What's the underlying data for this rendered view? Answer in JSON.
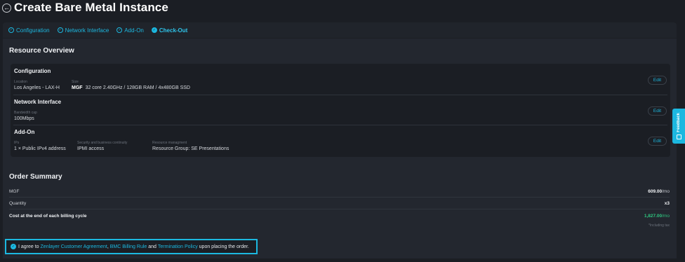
{
  "header": {
    "title": "Create Bare Metal Instance",
    "back_icon": "arrow-left-icon"
  },
  "steps": [
    {
      "label": "Configuration",
      "state": "done"
    },
    {
      "label": "Network Interface",
      "state": "done"
    },
    {
      "label": "Add-On",
      "state": "done"
    },
    {
      "label": "Check-Out",
      "state": "active"
    }
  ],
  "resource_overview": {
    "title": "Resource Overview",
    "edit_label": "Edit",
    "configuration": {
      "title": "Configuration",
      "location_label": "Location",
      "location_value": "Los Angeles - LAX-H",
      "size_label": "Size",
      "size_model": "MGF",
      "size_value": "32 core 2.40GHz / 128GB RAM / 4x480GB SSD"
    },
    "network": {
      "title": "Network Interface",
      "bandwidth_label": "Bandwidth cap",
      "bandwidth_value": "100Mbps"
    },
    "addon": {
      "title": "Add-On",
      "ips_label": "IPs",
      "ips_value": "1 × Public IPv4 address",
      "security_label": "Security and business continuity",
      "security_value": "IPMI access",
      "resource_label": "Resource managment",
      "resource_value": "Resource Group: SE Presentations"
    }
  },
  "order_summary": {
    "title": "Order Summary",
    "rows": [
      {
        "label": "MGF",
        "value": "609.00",
        "suffix": "/mo"
      },
      {
        "label": "Quantity",
        "value": "x3",
        "suffix": ""
      }
    ],
    "total_label": "Cost at the end of each billing cycle",
    "total_value": "1,827.00",
    "total_suffix": "/mo",
    "tax_note": "*Including tax"
  },
  "agreement": {
    "prefix": "I agree to",
    "link1": "Zenlayer Customer Agreement",
    "sep1": ",",
    "link2": "BMC Billing Rule",
    "and": "and",
    "link3": "Termination Policy",
    "suffix": "upon placing the order."
  },
  "feedback": {
    "label": "Feedback"
  },
  "colors": {
    "accent": "#1cb8e0",
    "total_green": "#2ec47f",
    "background": "#1b1e24",
    "panel": "#23272f"
  }
}
